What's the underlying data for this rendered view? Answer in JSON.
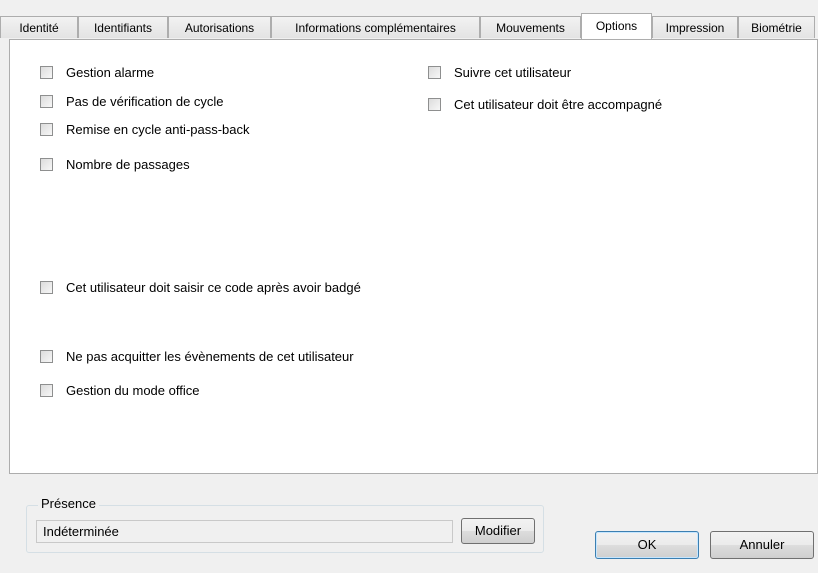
{
  "tabs": [
    {
      "label": "Identité",
      "active": false
    },
    {
      "label": "Identifiants",
      "active": false
    },
    {
      "label": "Autorisations",
      "active": false
    },
    {
      "label": "Informations complémentaires",
      "active": false
    },
    {
      "label": "Mouvements",
      "active": false
    },
    {
      "label": "Options",
      "active": true
    },
    {
      "label": "Impression",
      "active": false
    },
    {
      "label": "Biométrie",
      "active": false
    }
  ],
  "options": {
    "alarm": {
      "label": "Gestion alarme",
      "checked": false
    },
    "no_cycle_check": {
      "label": "Pas de vérification de cycle",
      "checked": false
    },
    "antipassback_reset": {
      "label": "Remise en cycle anti-pass-back",
      "checked": false
    },
    "pass_count": {
      "label": "Nombre de passages",
      "checked": false
    },
    "follow_user": {
      "label": "Suivre cet utilisateur",
      "checked": false
    },
    "escort_required": {
      "label": "Cet utilisateur doit être accompagné",
      "checked": false
    },
    "code_after_badge": {
      "label": "Cet utilisateur doit saisir ce code après avoir badgé",
      "checked": false
    },
    "no_ack_events": {
      "label": "Ne pas acquitter les évènements de cet utilisateur",
      "checked": false
    },
    "office_mode": {
      "label": "Gestion du mode office",
      "checked": false
    }
  },
  "presence": {
    "legend": "Présence",
    "value": "Indéterminée",
    "modify_label": "Modifier"
  },
  "buttons": {
    "ok": "OK",
    "cancel": "Annuler"
  }
}
